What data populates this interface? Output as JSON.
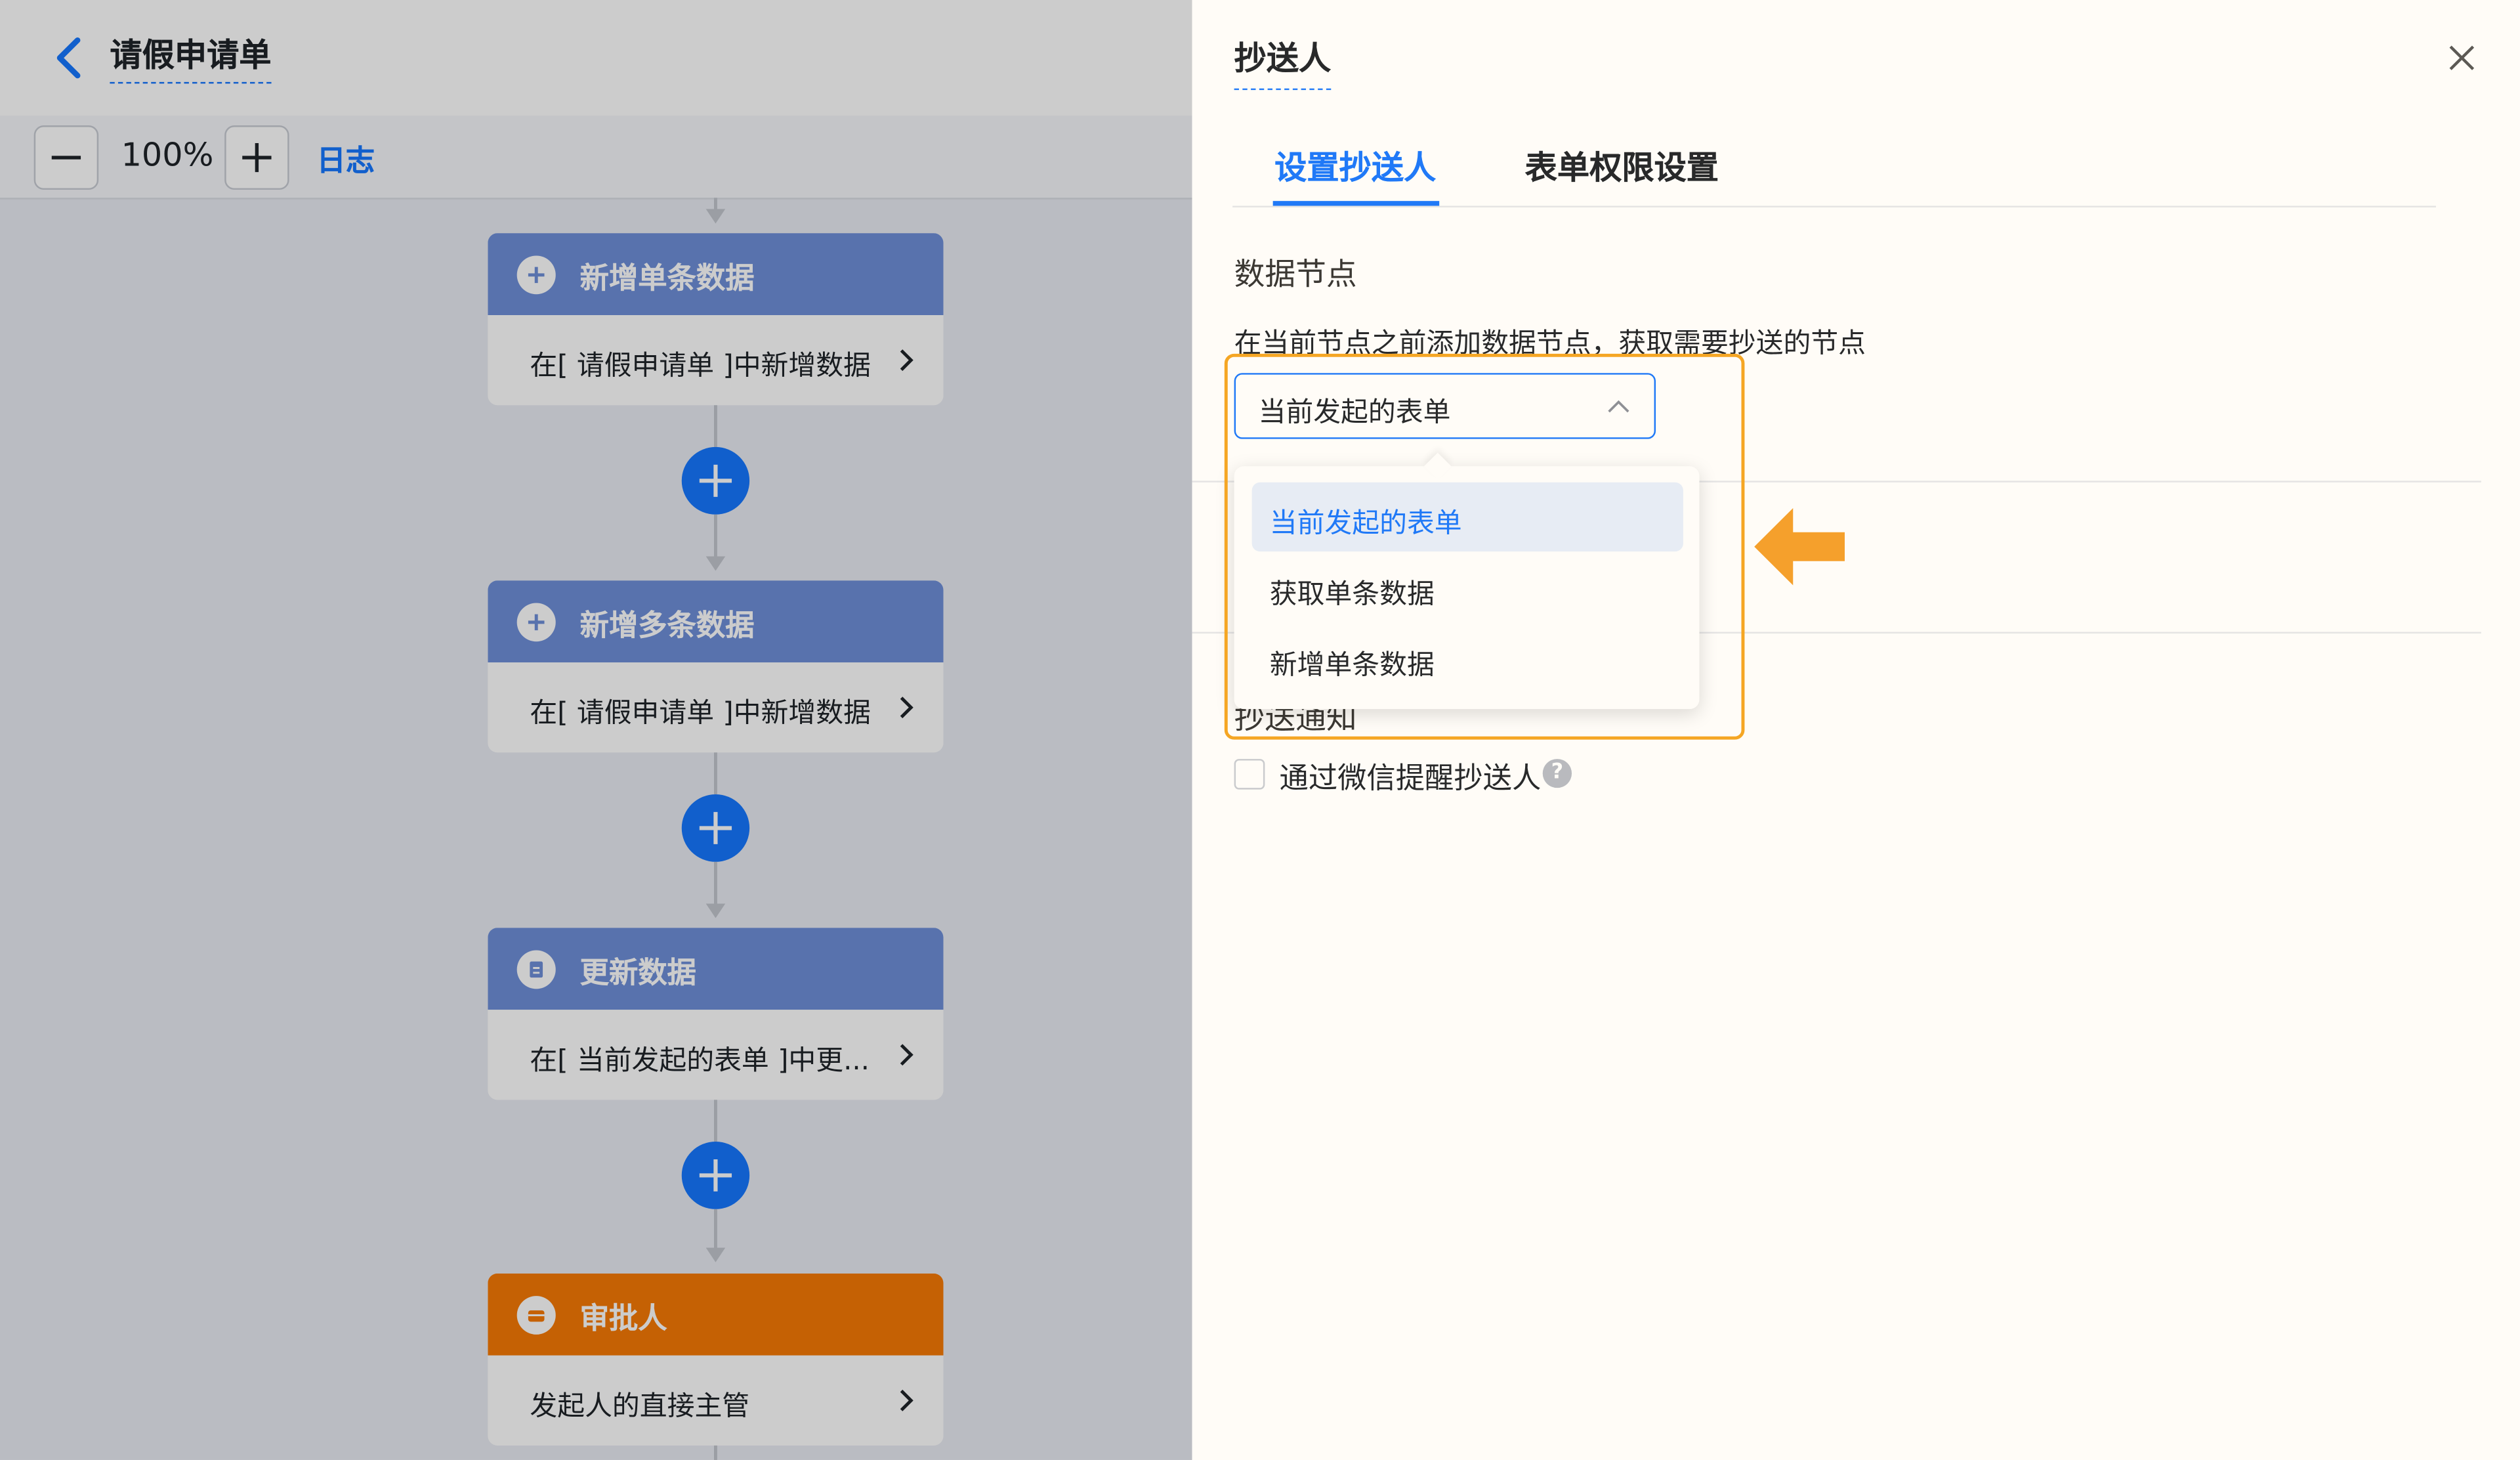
{
  "header": {
    "title": "请假申请单"
  },
  "toolbar": {
    "zoom": "100%",
    "log_label": "日志"
  },
  "flow": {
    "nodes": [
      {
        "title": "新增单条数据",
        "desc": "在[ 请假申请单 ]中新增数据",
        "icon": "plus-circle-icon",
        "color": "#6f8fd9"
      },
      {
        "title": "新增多条数据",
        "desc": "在[ 请假申请单 ]中新增数据",
        "icon": "plus-circle-icon",
        "color": "#6f8fd9"
      },
      {
        "title": "更新数据",
        "desc": "在[ 当前发起的表单 ]中更...",
        "icon": "document-icon",
        "color": "#6f8fd9"
      },
      {
        "title": "审批人",
        "desc": "发起人的直接主管",
        "icon": "approver-icon",
        "color": "#f77a06"
      }
    ]
  },
  "drawer": {
    "title": "抄送人",
    "tabs": [
      {
        "label": "设置抄送人",
        "active": true
      },
      {
        "label": "表单权限设置",
        "active": false
      }
    ],
    "data_node_label": "数据节点",
    "data_node_hint": "在当前节点之前添加数据节点，获取需要抄送的节点",
    "select_value": "当前发起的表单",
    "dropdown_options": [
      {
        "label": "当前发起的表单",
        "selected": true
      },
      {
        "label": "获取单条数据",
        "selected": false
      },
      {
        "label": "新增单条数据",
        "selected": false
      }
    ],
    "notify_label": "抄送通知",
    "wechat_label": "通过微信提醒抄送人",
    "wechat_checked": false
  },
  "colors": {
    "accent": "#1677ff",
    "highlight": "#f5a623",
    "node_blue": "#6f8fd9",
    "node_orange": "#f77a06"
  }
}
